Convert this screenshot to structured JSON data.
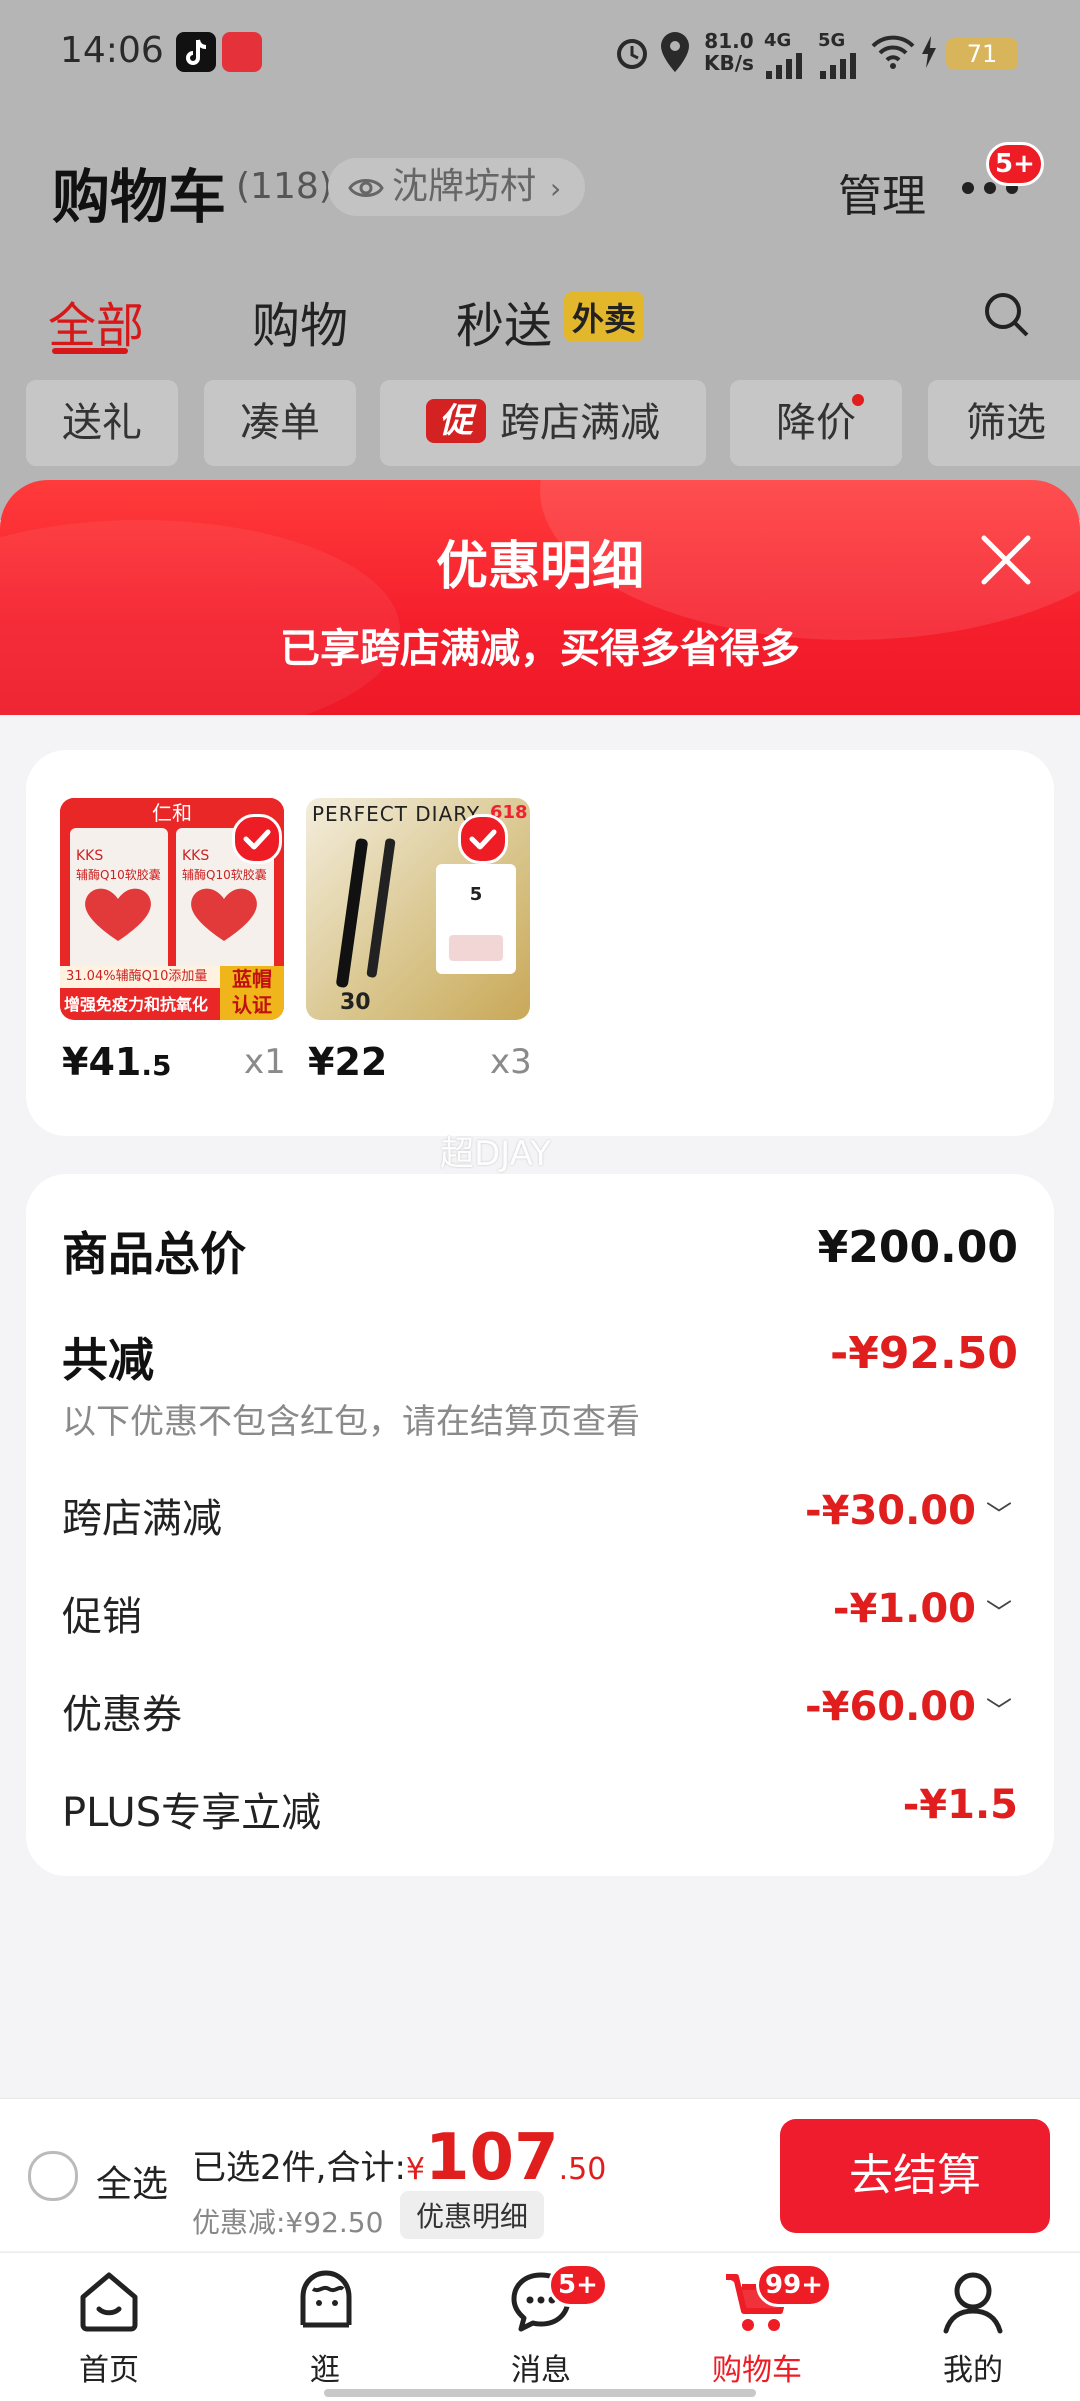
{
  "status_bar": {
    "time": "14:06",
    "net_speed_1": "81.0",
    "net_speed_2": "KB/s",
    "net_4g": "4G",
    "net_5g": "5G",
    "battery": "71"
  },
  "header": {
    "title": "购物车",
    "count": "(118)",
    "location": "沈牌坊村",
    "manage": "管理",
    "more_badge": "5+"
  },
  "tabs": [
    {
      "label": "全部",
      "active": true
    },
    {
      "label": "购物"
    },
    {
      "label": "秒送"
    }
  ],
  "tab_tag": "外卖",
  "chips": [
    "送礼",
    "凑单",
    "跨店满减",
    "降价",
    "筛选"
  ],
  "chip_promo_tag": "促",
  "sheet": {
    "title": "优惠明细",
    "subtitle": "已享跨店满减，买得多省得多"
  },
  "products": [
    {
      "price_main": "¥41",
      "price_dec": ".5",
      "qty": "x1",
      "img": {
        "logo": "仁和",
        "line1": "KKS",
        "line2": "辅酶Q10软胶囊",
        "pct": "31.04%辅酶Q10添加量",
        "bottom": "增强免疫力和抗氧化",
        "tag1": "蓝帽",
        "tag2": "认证"
      }
    },
    {
      "price_main": "¥22",
      "price_dec": "",
      "qty": "x3",
      "img": {
        "brand": "PERFECT DIARY",
        "badge": "618",
        "num": "30",
        "num2": "5"
      }
    }
  ],
  "watermark": "超DJAY",
  "summary": {
    "total_label": "商品总价",
    "total_value": "¥200.00",
    "discount_label": "共减",
    "discount_value": "-¥92.50",
    "note": "以下优惠不包含红包，请在结算页查看",
    "rows": [
      {
        "label": "跨店满减",
        "value": "-¥30.00",
        "chevron": true
      },
      {
        "label": "促销",
        "value": "-¥1.00",
        "chevron": true
      },
      {
        "label": "优惠券",
        "value": "-¥60.00",
        "chevron": true
      },
      {
        "label": "PLUS专享立减",
        "value": "-¥1.5",
        "chevron": false
      }
    ]
  },
  "checkout": {
    "select_all": "全选",
    "selected_text": "已选2件,合计:",
    "currency": "¥",
    "amount_int": "107",
    "amount_dec": ".50",
    "saved": "优惠减:¥92.50",
    "detail_btn": "优惠明细",
    "pay_btn": "去结算"
  },
  "nav": [
    {
      "label": "首页",
      "icon": "home-icon"
    },
    {
      "label": "逛",
      "icon": "browse-icon"
    },
    {
      "label": "消息",
      "icon": "message-icon",
      "badge": "5+"
    },
    {
      "label": "购物车",
      "icon": "cart-icon",
      "badge": "99+",
      "active": true
    },
    {
      "label": "我的",
      "icon": "profile-icon"
    }
  ],
  "colors": {
    "accent": "#ee1c25",
    "active_tab": "#d81818",
    "background": "#f4f4f6",
    "overlay": "#b5b5b5"
  }
}
